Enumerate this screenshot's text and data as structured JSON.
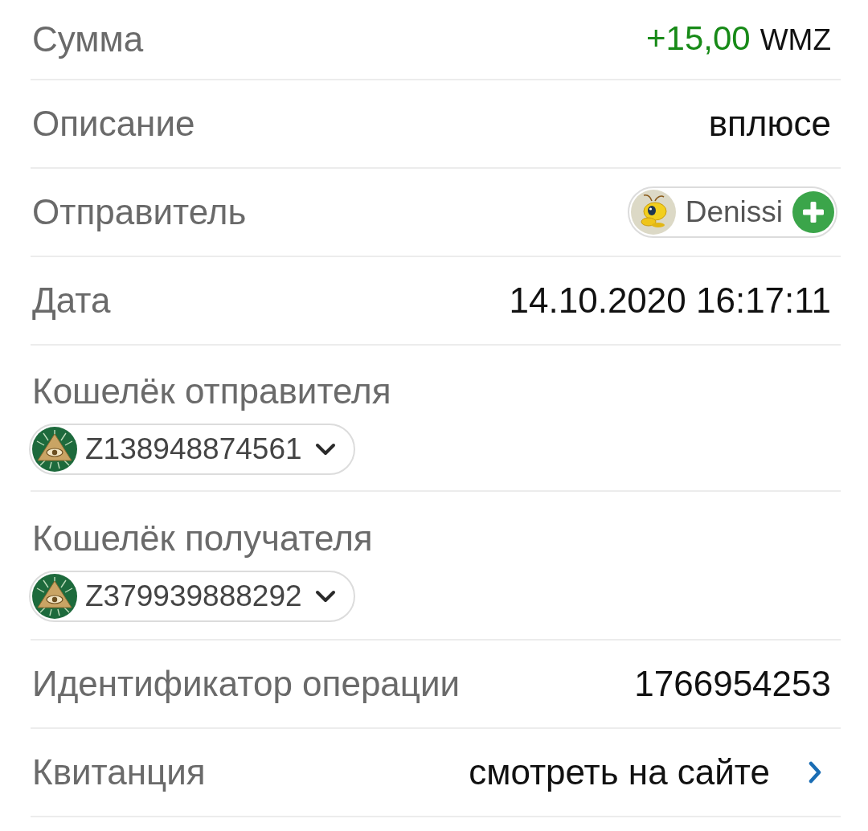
{
  "rows": [
    {
      "kind": "amount",
      "label": "Сумма",
      "amount": "+15,00",
      "currency": "WMZ"
    },
    {
      "kind": "text",
      "label": "Описание",
      "value": "вплюсе"
    },
    {
      "kind": "contact",
      "label": "Отправитель",
      "name": "Denissi"
    },
    {
      "kind": "text",
      "label": "Дата",
      "value": "14.10.2020 16:17:11"
    },
    {
      "kind": "wallet",
      "label": "Кошелёк отправителя",
      "wallet": "Z138948874561"
    },
    {
      "kind": "wallet",
      "label": "Кошелёк получателя",
      "wallet": "Z379939888292"
    },
    {
      "kind": "text",
      "label": "Идентификатор операции",
      "value": "1766954253"
    },
    {
      "kind": "link",
      "label": "Квитанция",
      "value": "смотреть на сайте"
    }
  ]
}
